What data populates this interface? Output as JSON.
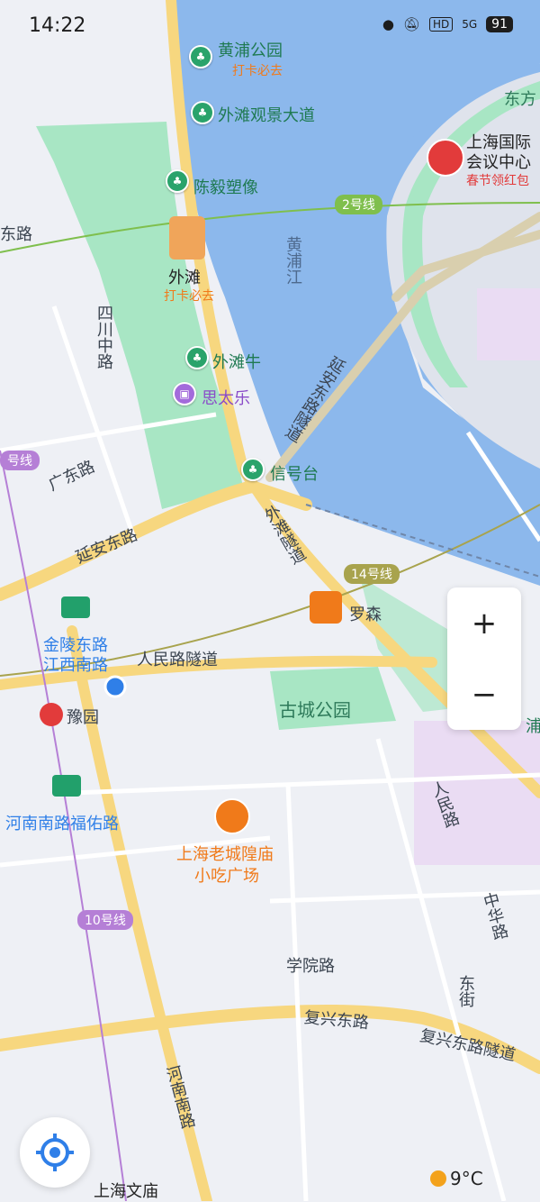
{
  "status_bar": {
    "time": "14:22",
    "network": "5G",
    "hd": "HD",
    "battery": "91"
  },
  "river": {
    "name": "黄浦江"
  },
  "roads": {
    "sichuan": "四川中路",
    "guangdong": "广东路",
    "yanan_east": "延安东路",
    "yanan_tunnel": "延安东路隧道",
    "waitan_tunnel": "外滩隧道",
    "renmin_tunnel": "人民路隧道",
    "renmin": "人民路",
    "zhonghua": "中华路",
    "dongjie": "东街",
    "xueyuan": "学院路",
    "fuxing_east": "复兴东路",
    "fuxing_tunnel": "复兴东路隧道",
    "henan_south": "河南南路",
    "left_edge": "东路"
  },
  "metro_lines": {
    "line2": "2号线",
    "line14": "14号线",
    "line10": "10号线",
    "left_line": "号线"
  },
  "pois": {
    "huangpu_park": "黄浦公园",
    "huangpu_park_tag": "打卡必去",
    "bund_avenue": "外滩观景大道",
    "chenyi_statue": "陈毅塑像",
    "bund": "外滩",
    "bund_tag": "打卡必去",
    "bund_bull": "外滩牛",
    "sitaile": "思太乐",
    "signal_tower": "信号台",
    "lawson": "罗森",
    "old_city_park": "古城公园",
    "shanghai_intl_1": "上海国际",
    "shanghai_intl_2": "会议中心",
    "spring_tag": "春节领红包",
    "east_label": "东方",
    "jinling_station_1": "金陵东路",
    "jinling_station_2": "江西南路",
    "yuyuan": "豫园",
    "henan_fuyou": "河南南路福佑路",
    "old_city_food_1": "上海老城隍庙",
    "old_city_food_2": "小吃广场",
    "wenmiao": "上海文庙",
    "right_poi": "浦"
  },
  "map_controls": {
    "zoom_in": "+",
    "zoom_out": "−"
  },
  "weather": {
    "temperature": "9°C"
  },
  "colors": {
    "water": "#8cb8ec",
    "park": "#a8e6c4",
    "road": "#f7d77f",
    "green_pin": "#2aa36b",
    "accent_blue": "#2f7fe8"
  }
}
